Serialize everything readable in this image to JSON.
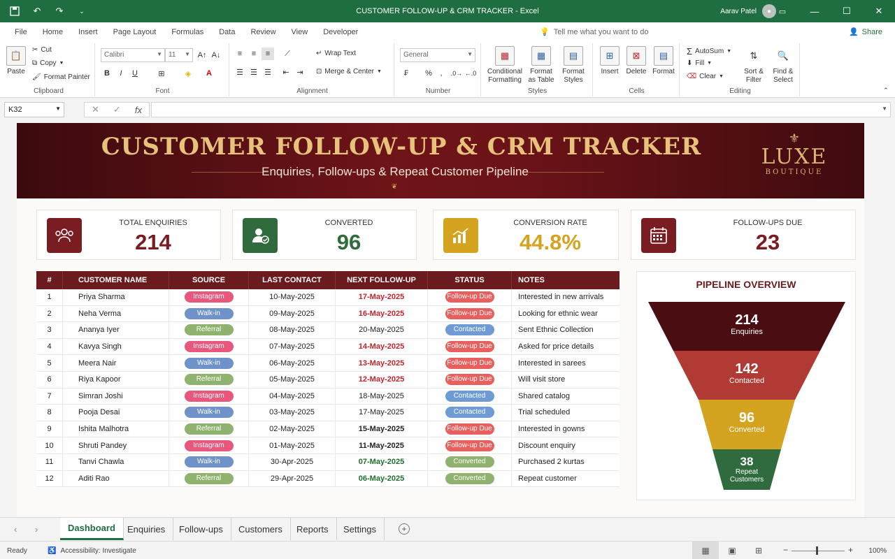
{
  "window": {
    "title": "CUSTOMER FOLLOW-UP & CRM TRACKER - Excel",
    "user": "Aarav Patel",
    "accent": "#1e6e42"
  },
  "menu": {
    "tabs": [
      "File",
      "Home",
      "Insert",
      "Page Layout",
      "Formulas",
      "Data",
      "Review",
      "View",
      "Developer"
    ],
    "tell_me": "Tell me what you want to do",
    "share": "Share"
  },
  "ribbon": {
    "clipboard": {
      "paste": "Paste",
      "cut": "Cut",
      "copy": "Copy",
      "format_painter": "Format Painter",
      "label": "Clipboard"
    },
    "font": {
      "name": "Calibri",
      "size": "11",
      "label": "Font"
    },
    "alignment": {
      "wrap": "Wrap Text",
      "merge": "Merge & Center",
      "label": "Alignment"
    },
    "number": {
      "format": "General",
      "label": "Number"
    },
    "styles": {
      "conditional": "Conditional Formatting",
      "table": "Format as Table",
      "cell": "Format Styles",
      "label": "Styles"
    },
    "cells": {
      "insert": "Insert",
      "delete": "Delete",
      "format": "Format",
      "label": "Cells"
    },
    "editing": {
      "autosum": "AutoSum",
      "fill": "Fill",
      "clear": "Clear",
      "sort": "Sort & Filter",
      "find": "Find & Select",
      "label": "Editing"
    }
  },
  "formula_bar": {
    "name_box": "K32",
    "formula": ""
  },
  "banner": {
    "title": "CUSTOMER FOLLOW-UP & CRM TRACKER",
    "subtitle": "Enquiries, Follow-ups & Repeat Customer Pipeline",
    "brand": "LUXE",
    "brand_sub": "BOUTIQUE"
  },
  "kpis": [
    {
      "label": "TOTAL ENQUIRIES",
      "value": "214",
      "color": "#7a1d22",
      "icon": "people-icon"
    },
    {
      "label": "CONVERTED",
      "value": "96",
      "color": "#2f6b3c",
      "icon": "user-check-icon"
    },
    {
      "label": "CONVERSION RATE",
      "value": "44.8%",
      "color": "#d4a320",
      "icon": "growth-chart-icon"
    },
    {
      "label": "FOLLOW-UPS DUE",
      "value": "23",
      "color": "#7a1d22",
      "icon": "calendar-icon"
    }
  ],
  "table": {
    "headers": [
      "#",
      "CUSTOMER NAME",
      "SOURCE",
      "LAST CONTACT",
      "NEXT FOLLOW-UP",
      "STATUS",
      "NOTES"
    ],
    "rows": [
      {
        "n": "1",
        "name": "Priya Sharma",
        "source": "Instagram",
        "last": "10-May-2025",
        "next": "17-May-2025",
        "next_style": "red",
        "status": "Follow-up Due",
        "notes": "Interested in new arrivals"
      },
      {
        "n": "2",
        "name": "Neha Verma",
        "source": "Walk-in",
        "last": "09-May-2025",
        "next": "16-May-2025",
        "next_style": "red",
        "status": "Follow-up Due",
        "notes": "Looking for ethnic wear"
      },
      {
        "n": "3",
        "name": "Ananya Iyer",
        "source": "Referral",
        "last": "08-May-2025",
        "next": "20-May-2025",
        "next_style": "",
        "status": "Contacted",
        "notes": "Sent Ethnic Collection"
      },
      {
        "n": "4",
        "name": "Kavya Singh",
        "source": "Instagram",
        "last": "07-May-2025",
        "next": "14-May-2025",
        "next_style": "red",
        "status": "Follow-up Due",
        "notes": "Asked for price details"
      },
      {
        "n": "5",
        "name": "Meera Nair",
        "source": "Walk-in",
        "last": "06-May-2025",
        "next": "13-May-2025",
        "next_style": "red",
        "status": "Follow-up Due",
        "notes": "Interested in sarees"
      },
      {
        "n": "6",
        "name": "Riya Kapoor",
        "source": "Referral",
        "last": "05-May-2025",
        "next": "12-May-2025",
        "next_style": "red",
        "status": "Follow-up Due",
        "notes": "Will visit store"
      },
      {
        "n": "7",
        "name": "Simran Joshi",
        "source": "Instagram",
        "last": "04-May-2025",
        "next": "18-May-2025",
        "next_style": "",
        "status": "Contacted",
        "notes": "Shared catalog"
      },
      {
        "n": "8",
        "name": "Pooja Desai",
        "source": "Walk-in",
        "last": "03-May-2025",
        "next": "17-May-2025",
        "next_style": "",
        "status": "Contacted",
        "notes": "Trial scheduled"
      },
      {
        "n": "9",
        "name": "Ishita Malhotra",
        "source": "Referral",
        "last": "02-May-2025",
        "next": "15-May-2025",
        "next_style": "bold",
        "status": "Follow-up Due",
        "notes": "Interested in gowns"
      },
      {
        "n": "10",
        "name": "Shruti Pandey",
        "source": "Instagram",
        "last": "01-May-2025",
        "next": "11-May-2025",
        "next_style": "bold",
        "status": "Follow-up Due",
        "notes": "Discount enquiry"
      },
      {
        "n": "11",
        "name": "Tanvi Chawla",
        "source": "Walk-in",
        "last": "30-Apr-2025",
        "next": "07-May-2025",
        "next_style": "green",
        "status": "Converted",
        "notes": "Purchased 2 kurtas"
      },
      {
        "n": "12",
        "name": "Aditi Rao",
        "source": "Referral",
        "last": "29-Apr-2025",
        "next": "06-May-2025",
        "next_style": "green",
        "status": "Converted",
        "notes": "Repeat customer"
      }
    ]
  },
  "colors": {
    "Instagram": "#e8577c",
    "Walk-in": "#6f93c9",
    "Referral": "#8fb36e",
    "Follow-up Due": "#e8605d",
    "Contacted": "#6f9bd4",
    "Converted": "#8fb36e"
  },
  "pipeline": {
    "title": "PIPELINE OVERVIEW",
    "stages": [
      {
        "value": "214",
        "label": "Enquiries",
        "color": "#4a0d12"
      },
      {
        "value": "142",
        "label": "Contacted",
        "color": "#b23a34"
      },
      {
        "value": "96",
        "label": "Converted",
        "color": "#d4a320"
      },
      {
        "value": "38",
        "label": "Repeat Customers",
        "color": "#2f6b3c"
      }
    ]
  },
  "sheets": [
    "Dashboard",
    "Enquiries",
    "Follow-ups",
    "Customers",
    "Reports",
    "Settings"
  ],
  "status": {
    "ready": "Ready",
    "accessibility": "Accessibility: Investigate",
    "zoom": "100%"
  }
}
